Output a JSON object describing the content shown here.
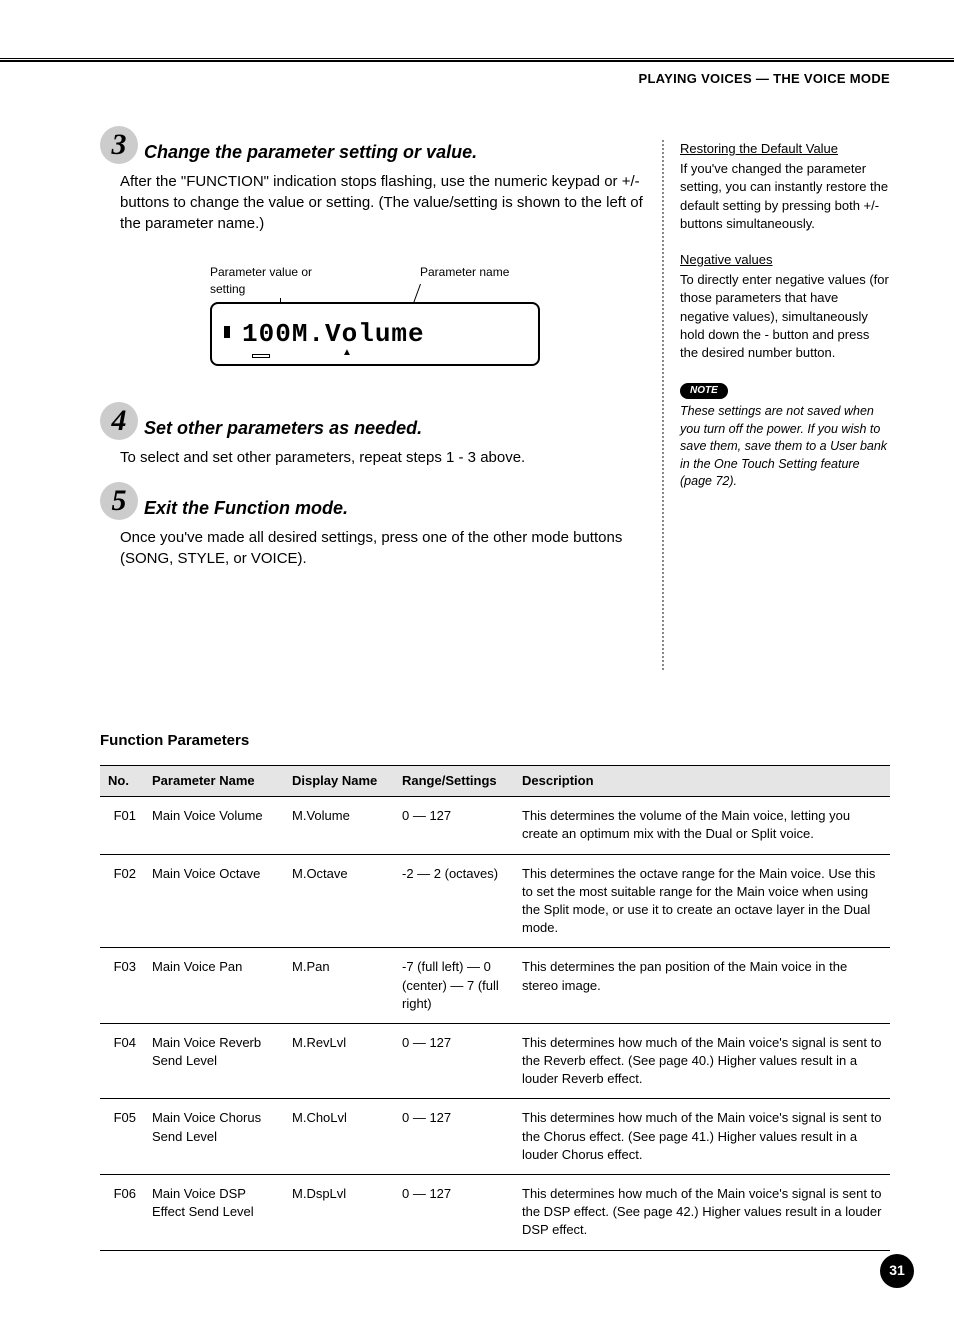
{
  "header": {
    "section_title": "PLAYING VOICES — THE VOICE MODE"
  },
  "steps": [
    {
      "num": "3",
      "title": "Change the parameter setting or value.",
      "body": "After the \"FUNCTION\" indication stops flashing, use the numeric keypad or +/- buttons to change the value or setting.  (The value/setting is shown to the left of the parameter name.)"
    },
    {
      "num": "4",
      "title": "Set other parameters as needed.",
      "body": "To select and set other parameters, repeat steps 1 - 3 above."
    },
    {
      "num": "5",
      "title": "Exit the Function mode.",
      "body": "Once you've made all desired settings, press one of the other mode buttons (SONG, STYLE, or VOICE)."
    }
  ],
  "figure": {
    "label_left": "Parameter value or setting",
    "label_right": "Parameter name",
    "display_value": "100",
    "display_name": "M.Volume"
  },
  "sidebar": {
    "restore": {
      "heading": "Restoring the Default Value",
      "body": "If you've changed the parameter setting, you can instantly restore the default setting by pressing both +/- buttons simultaneously."
    },
    "negative": {
      "heading": "Negative values",
      "body": "To directly enter negative values (for those parameters that have negative values), simultaneously hold down the - button and press the desired number button."
    },
    "note": {
      "badge": "NOTE",
      "body": "These settings are not saved when you turn off the power.  If you wish to save them, save them to a User bank in the One Touch Setting feature (page 72)."
    }
  },
  "params": {
    "title": "Function Parameters",
    "headers": {
      "no": "No.",
      "pname": "Parameter Name",
      "dname": "Display Name",
      "range": "Range/Settings",
      "desc": "Description"
    },
    "rows": [
      {
        "no": "F01",
        "pname": "Main Voice Volume",
        "dname": "M.Volume",
        "range": "0 — 127",
        "desc": "This determines the volume of the Main voice, letting you create an optimum mix with the Dual or Split voice."
      },
      {
        "no": "F02",
        "pname": "Main Voice Octave",
        "dname": "M.Octave",
        "range": "-2 — 2 (octaves)",
        "desc": "This determines the octave range for the Main voice. Use this to set the most suitable range for the Main voice when using the Split mode, or use it to create an octave layer in the Dual mode."
      },
      {
        "no": "F03",
        "pname": "Main Voice Pan",
        "dname": "M.Pan",
        "range": "-7 (full left) — 0 (center) — 7 (full right)",
        "desc": "This determines the pan position of the Main voice in the stereo image."
      },
      {
        "no": "F04",
        "pname": "Main Voice Reverb Send Level",
        "dname": "M.RevLvl",
        "range": "0 — 127",
        "desc": "This determines how much of the Main voice's signal is sent to the Reverb effect.  (See page 40.)  Higher values result in a louder Reverb effect."
      },
      {
        "no": "F05",
        "pname": "Main Voice Chorus Send Level",
        "dname": "M.ChoLvl",
        "range": "0 — 127",
        "desc": "This determines how much of the Main voice's signal is sent to the Chorus effect.  (See page 41.)  Higher values result in a louder Chorus effect."
      },
      {
        "no": "F06",
        "pname": "Main Voice DSP Effect Send Level",
        "dname": "M.DspLvl",
        "range": "0 — 127",
        "desc": "This determines how much of the Main voice's signal is sent to the DSP effect.  (See page 42.)  Higher values result in a louder DSP effect."
      }
    ]
  },
  "page_number": "31"
}
